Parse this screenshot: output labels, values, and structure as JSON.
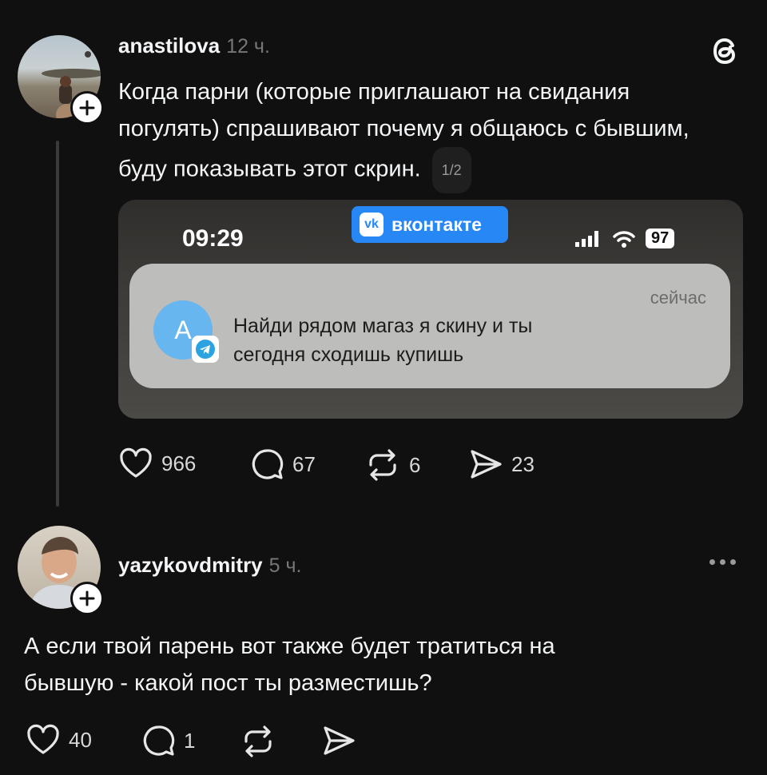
{
  "post": {
    "username": "anastilova",
    "time": "12 ч.",
    "text": "Когда парни (которые приглашают на свидания погулять) спрашивают почему я общаюсь с бывшим, буду показывать этот скрин.",
    "pager": "1/2",
    "screenshot": {
      "time": "09:29",
      "vk_label": "вконтакте",
      "battery": "97",
      "notification": {
        "avatar_letter": "А",
        "when": "сейчас",
        "message_line1": "Найди рядом магаз я скину и ты",
        "message_line2": "сегодня сходишь купишь"
      }
    },
    "likes": "966",
    "comments": "67",
    "reposts": "6",
    "shares": "23"
  },
  "reply": {
    "username": "yazykovdmitry",
    "time": "5 ч.",
    "line1": "А если твой парень вот также будет тратиться на",
    "line2": "бывшую - какой пост ты разместишь?",
    "likes": "40",
    "comments": "1"
  },
  "colors": {
    "background": "#101010",
    "text": "#f3f5f7",
    "muted": "#777777",
    "vk_blue": "#2787f5",
    "telegram": "#2aa3e0"
  }
}
